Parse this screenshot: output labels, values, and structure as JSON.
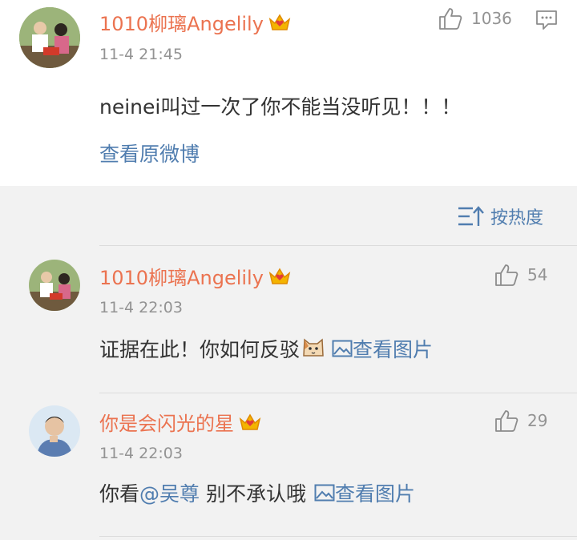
{
  "main_comment": {
    "username": "1010柳璃Angelily",
    "timestamp": "11-4 21:45",
    "like_count": "1036",
    "text": "neinei叫过一次了你不能当没听见！！！",
    "view_original": "查看原微博"
  },
  "sort": {
    "label": "按热度"
  },
  "replies": [
    {
      "username": "1010柳璃Angelily",
      "timestamp": "11-4 22:03",
      "like_count": "54",
      "text": "证据在此！你如何反驳",
      "image_link": "查看图片"
    },
    {
      "username": "你是会闪光的星",
      "timestamp": "11-4 22:03",
      "like_count": "29",
      "text_before": "你看",
      "mention": "@吴尊",
      "text_after": " 别不承认哦",
      "image_link": "查看图片"
    }
  ],
  "colors": {
    "username": "#eb7350",
    "link": "#507daf",
    "meta": "#939393",
    "lower_bg": "#f2f2f2"
  },
  "icons": [
    "crown-badge-icon",
    "thumbs-up-icon",
    "comment-icon",
    "sort-icon",
    "cat-emoji-icon",
    "image-icon"
  ]
}
